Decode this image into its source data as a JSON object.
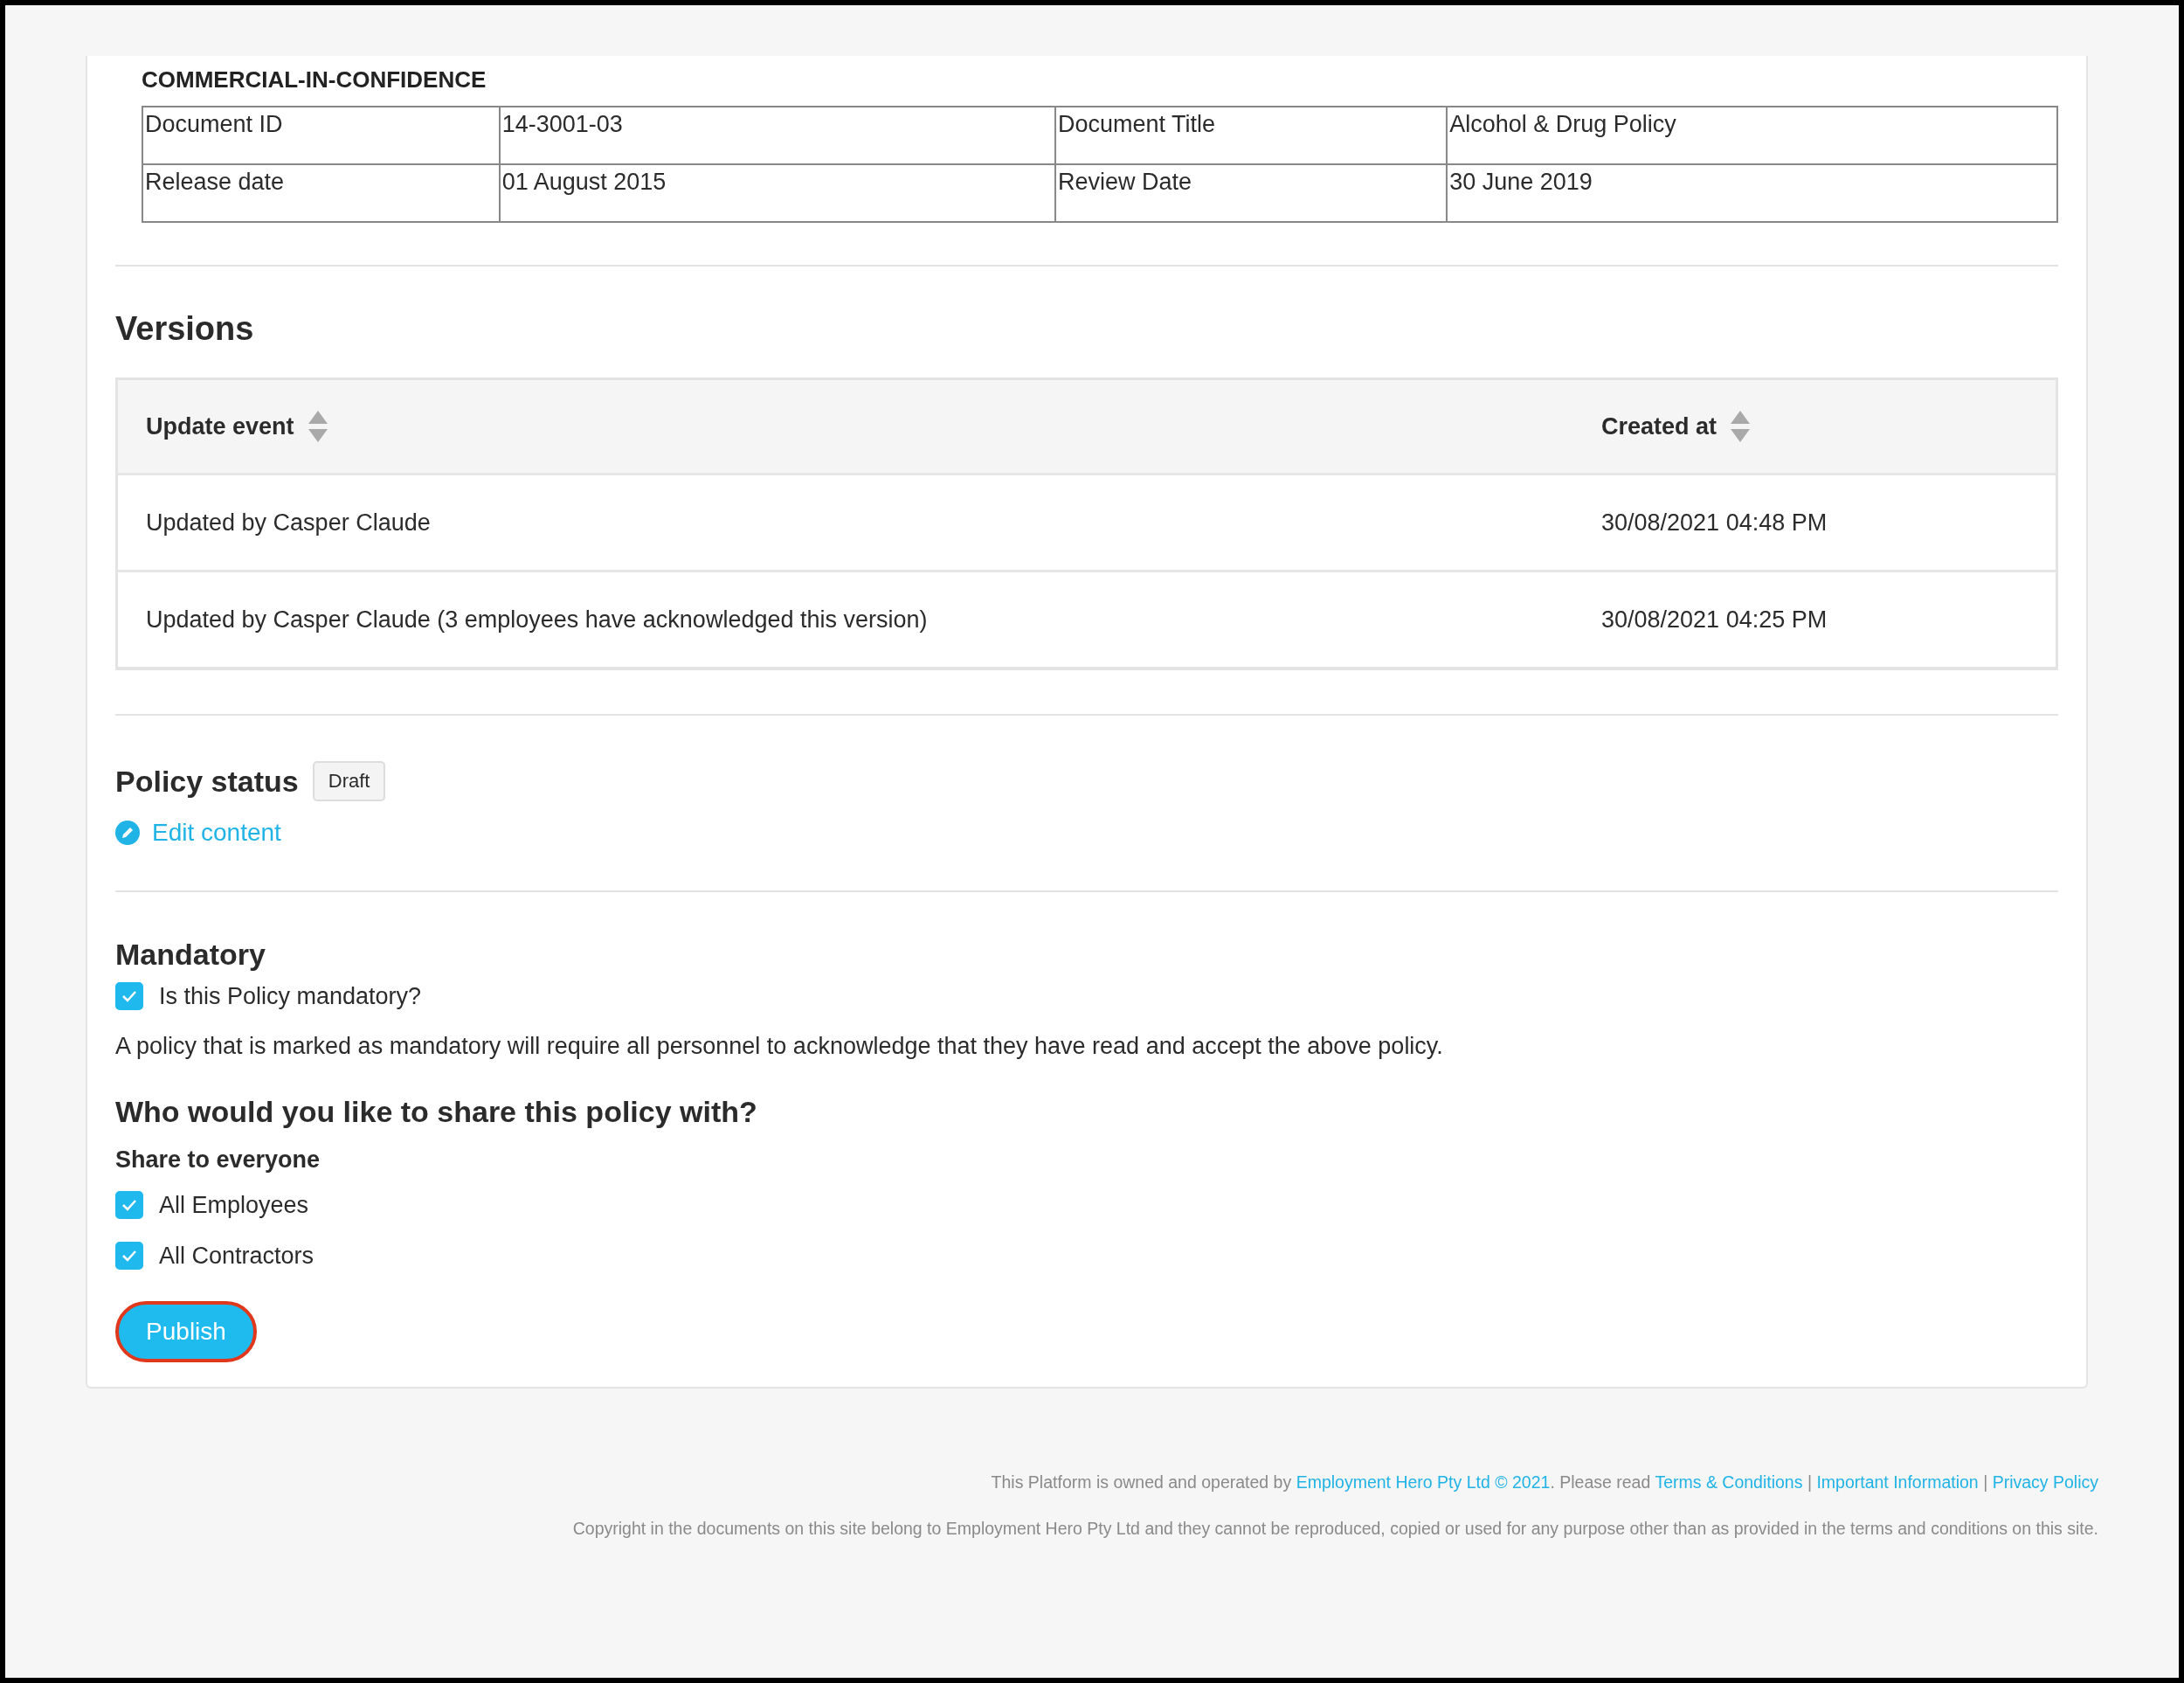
{
  "classification": "COMMERCIAL-IN-CONFIDENCE",
  "document_info": {
    "rows": [
      [
        "Document ID",
        "14-3001-03",
        "Document Title",
        "Alcohol & Drug Policy"
      ],
      [
        "Release date",
        "01 August 2015",
        "Review Date",
        "30 June 2019"
      ]
    ]
  },
  "versions": {
    "title": "Versions",
    "columns": [
      {
        "label": "Update event"
      },
      {
        "label": "Created at"
      }
    ],
    "rows": [
      {
        "event": "Updated by Casper Claude",
        "created_at": "30/08/2021 04:48 PM"
      },
      {
        "event": "Updated by Casper Claude (3 employees have acknowledged this version)",
        "created_at": "30/08/2021 04:25 PM"
      }
    ]
  },
  "policy_status": {
    "title": "Policy status",
    "badge": "Draft",
    "edit_link": "Edit content"
  },
  "mandatory": {
    "title": "Mandatory",
    "checkbox": {
      "label": "Is this Policy mandatory?",
      "checked": true
    },
    "description": "A policy that is marked as mandatory will require all personnel to acknowledge that they have read and accept the above policy."
  },
  "sharing": {
    "title": "Who would you like to share this policy with?",
    "subtitle": "Share to everyone",
    "options": [
      {
        "label": "All Employees",
        "checked": true
      },
      {
        "label": "All Contractors",
        "checked": true
      }
    ]
  },
  "publish_button": "Publish",
  "footer": {
    "line_1": [
      {
        "kind": "text",
        "text": "This Platform is owned and operated by "
      },
      {
        "kind": "link",
        "text": "Employment Hero Pty Ltd © 2021"
      },
      {
        "kind": "text",
        "text": ". Please read "
      },
      {
        "kind": "link",
        "text": "Terms & Conditions"
      },
      {
        "kind": "text",
        "text": " | "
      },
      {
        "kind": "link",
        "text": "Important Information"
      },
      {
        "kind": "text",
        "text": " | "
      },
      {
        "kind": "link",
        "text": "Privacy Policy"
      }
    ],
    "line_2": "Copyright in the documents on this site belong to Employment Hero Pty Ltd and they cannot be reproduced, copied or used for any purpose other than as provided in the terms and conditions on this site."
  }
}
